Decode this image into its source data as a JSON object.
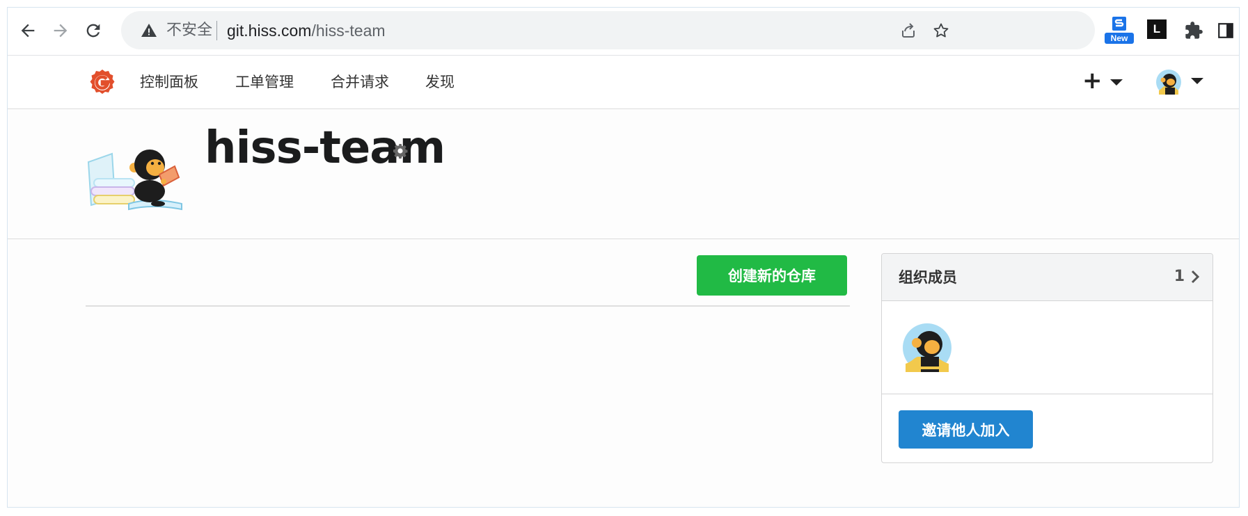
{
  "browser": {
    "omnibox": {
      "security_label": "不安全",
      "url_host": "git.hiss.com",
      "url_path": "/hiss-team"
    },
    "extensions": {
      "new_badge": "New",
      "l_label": "L"
    }
  },
  "navbar": {
    "items": [
      {
        "label": "控制面板"
      },
      {
        "label": "工单管理"
      },
      {
        "label": "合并请求"
      },
      {
        "label": "发现"
      }
    ],
    "plus_label": "+"
  },
  "org": {
    "name": "hiss-team"
  },
  "main": {
    "new_repo_button": "创建新的仓库",
    "members": {
      "title": "组织成员",
      "count": "1",
      "invite_button": "邀请他人加入"
    }
  },
  "colors": {
    "gitea_logo": "#e24f2c",
    "primary_green": "#21ba45",
    "primary_blue": "#2185d0",
    "browser_new_badge": "#1a73e8"
  }
}
